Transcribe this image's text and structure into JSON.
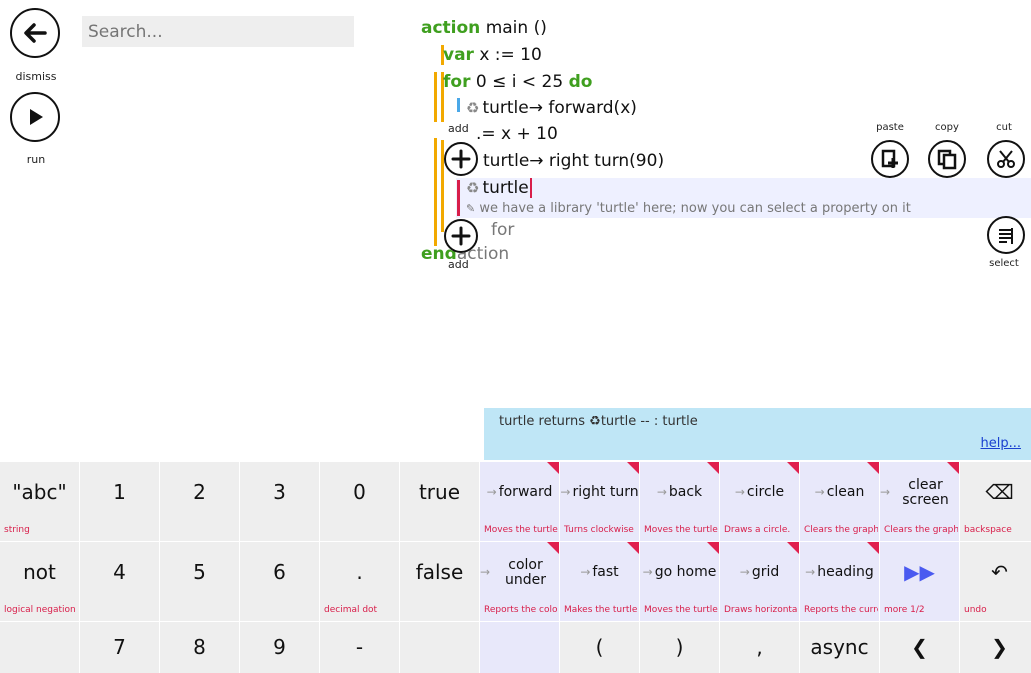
{
  "toolbar": {
    "dismiss_label": "dismiss",
    "run_label": "run"
  },
  "search": {
    "placeholder": "Search..."
  },
  "code": {
    "line1_kw": "action",
    "line1_rest": "main ()",
    "line2_kw": "var",
    "line2_rest": "x := 10",
    "line3_kw": "for",
    "line3_mid": "0 ≤ i < 25",
    "line3_kw2": "do",
    "line4": "turtle→ forward(x)",
    "line5": ".= x + 10",
    "line6": "turtle→ right turn(90)",
    "line7": "turtle",
    "hint": "we have a library 'turtle' here; now you can select a property on it",
    "end_for": "for",
    "end_action_kw": "end",
    "end_action_rest": "action",
    "add_label": "add"
  },
  "tools": {
    "paste": "paste",
    "copy": "copy",
    "cut": "cut",
    "select": "select"
  },
  "info": {
    "text": "turtle returns ♻turtle -- : turtle",
    "help": "help..."
  },
  "keys": {
    "row1": [
      {
        "main": "\"abc\"",
        "sub": "string"
      },
      {
        "main": "1",
        "sub": ""
      },
      {
        "main": "2",
        "sub": ""
      },
      {
        "main": "3",
        "sub": ""
      },
      {
        "main": "0",
        "sub": ""
      },
      {
        "main": "true",
        "sub": ""
      },
      {
        "main": "forward",
        "sub": "Moves the turtle"
      },
      {
        "main": "right turn",
        "sub": "Turns clockwise"
      },
      {
        "main": "back",
        "sub": "Moves the turtle"
      },
      {
        "main": "circle",
        "sub": "Draws a circle."
      },
      {
        "main": "clean",
        "sub": "Clears the graphics"
      },
      {
        "main": "clear screen",
        "sub": "Clears the graphics"
      },
      {
        "main": "⌫",
        "sub": "backspace"
      }
    ],
    "row2": [
      {
        "main": "not",
        "sub": "logical negation"
      },
      {
        "main": "4",
        "sub": ""
      },
      {
        "main": "5",
        "sub": ""
      },
      {
        "main": "6",
        "sub": ""
      },
      {
        "main": ".",
        "sub": "decimal dot"
      },
      {
        "main": "false",
        "sub": ""
      },
      {
        "main": "color under",
        "sub": "Reports the color"
      },
      {
        "main": "fast",
        "sub": "Makes the turtle"
      },
      {
        "main": "go home",
        "sub": "Moves the turtle"
      },
      {
        "main": "grid",
        "sub": "Draws horizontal"
      },
      {
        "main": "heading",
        "sub": "Reports the current"
      },
      {
        "main": "▶▶",
        "sub": "more 1/2"
      },
      {
        "main": "↶",
        "sub": "undo"
      }
    ],
    "row3": [
      {
        "main": "",
        "sub": ""
      },
      {
        "main": "7",
        "sub": ""
      },
      {
        "main": "8",
        "sub": ""
      },
      {
        "main": "9",
        "sub": ""
      },
      {
        "main": "-",
        "sub": ""
      },
      {
        "main": "",
        "sub": ""
      },
      {
        "main": "",
        "sub": ""
      },
      {
        "main": "(",
        "sub": ""
      },
      {
        "main": ")",
        "sub": ""
      },
      {
        "main": ",",
        "sub": ""
      },
      {
        "main": "async",
        "sub": ""
      },
      {
        "main": "❮",
        "sub": ""
      },
      {
        "main": "❯",
        "sub": ""
      }
    ]
  },
  "colors": {
    "keyword": "#3f9f1f",
    "bracket": "#f2a900",
    "accent_red": "#e0204e",
    "info_bg": "#bfe6f6"
  }
}
